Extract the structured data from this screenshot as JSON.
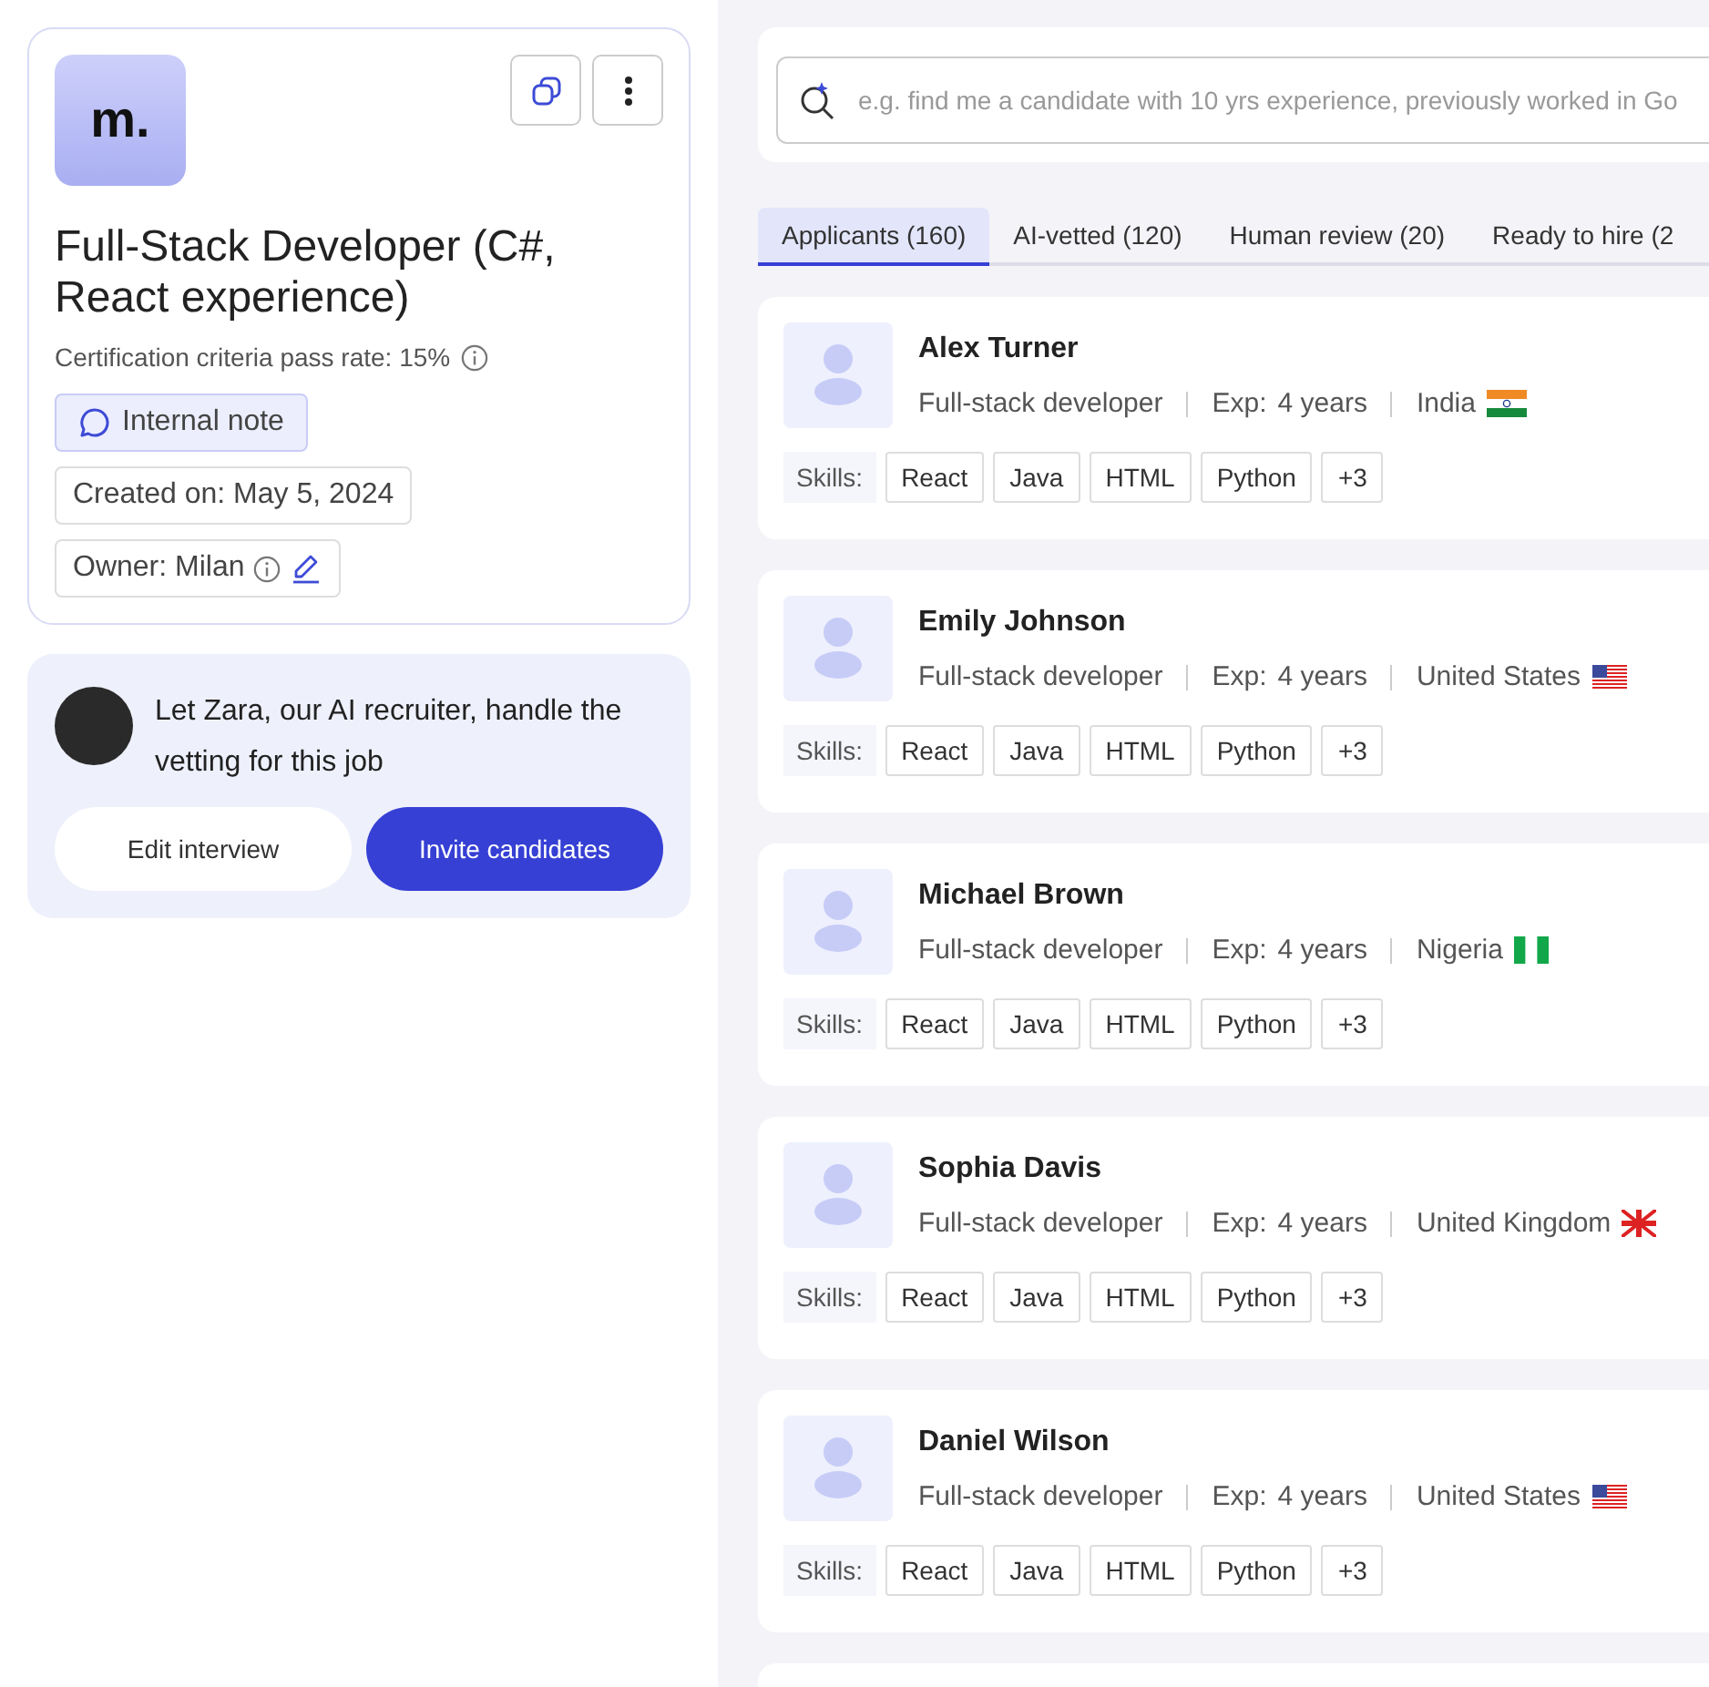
{
  "job": {
    "logo": "m.",
    "title": "Full-Stack Developer (C#, React experience)",
    "pass_rate": "Certification criteria pass rate: 15%",
    "internal_note": "Internal note",
    "created": "Created on: May 5, 2024",
    "owner": "Owner: Milan"
  },
  "promo": {
    "text": "Let Zara, our AI recruiter, handle the vetting for this job",
    "buttons": [
      {
        "label": "Edit interview",
        "kind": "secondary"
      },
      {
        "label": "Invite candidates",
        "kind": "primary"
      }
    ]
  },
  "search": {
    "placeholder": "e.g. find me a candidate with 10 yrs experience, previously worked in Go"
  },
  "tabs": [
    {
      "label": "Applicants (160)",
      "selected": true
    },
    {
      "label": "AI-vetted (120)",
      "selected": false
    },
    {
      "label": "Human review (20)",
      "selected": false
    },
    {
      "label": "Ready to hire (2",
      "selected": false
    }
  ],
  "candidates": [
    {
      "name": "Alex Turner",
      "role": "Full-stack developer",
      "exp_label": "Exp:",
      "exp": "4 years",
      "country": "India",
      "kind": "in",
      "skills_label": "Skills:",
      "skills": [
        "React",
        "Java",
        "HTML",
        "Python",
        "+3"
      ]
    },
    {
      "name": "Emily Johnson",
      "role": "Full-stack developer",
      "exp_label": "Exp:",
      "exp": "4 years",
      "country": "United States",
      "kind": "us",
      "skills_label": "Skills:",
      "skills": [
        "React",
        "Java",
        "HTML",
        "Python",
        "+3"
      ]
    },
    {
      "name": "Michael Brown",
      "role": "Full-stack developer",
      "exp_label": "Exp:",
      "exp": "4 years",
      "country": "Nigeria",
      "kind": "ng",
      "skills_label": "Skills:",
      "skills": [
        "React",
        "Java",
        "HTML",
        "Python",
        "+3"
      ]
    },
    {
      "name": "Sophia Davis",
      "role": "Full-stack developer",
      "exp_label": "Exp:",
      "exp": "4 years",
      "country": "United Kingdom",
      "kind": "uk",
      "skills_label": "Skills:",
      "skills": [
        "React",
        "Java",
        "HTML",
        "Python",
        "+3"
      ]
    },
    {
      "name": "Daniel Wilson",
      "role": "Full-stack developer",
      "exp_label": "Exp:",
      "exp": "4 years",
      "country": "United States",
      "kind": "us",
      "skills_label": "Skills:",
      "skills": [
        "React",
        "Java",
        "HTML",
        "Python",
        "+3"
      ]
    }
  ]
}
